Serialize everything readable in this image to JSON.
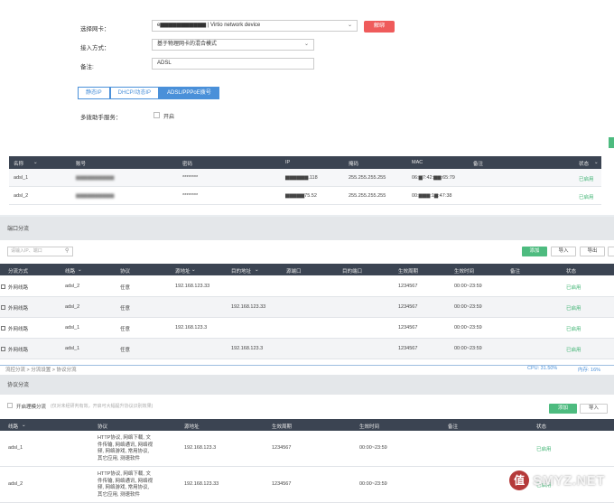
{
  "panel1": {
    "nic_label": "选择网卡：",
    "nic_value": "e▆▆▆▆▆▆▆▆▆▆▆ | Virtio network device",
    "unbind_button": "解绑",
    "access_label": "接入方式：",
    "access_value": "基于物理网卡的混合模式",
    "remark_label": "备注:",
    "remark_value": "ADSL",
    "tabs": [
      "静态IP",
      "DHCP/动态IP",
      "ADSL/PPPoE拨号"
    ],
    "active_tab": 2,
    "multi_service_label": "多拨助手服务：",
    "enable_label": "开启",
    "table": {
      "headers": [
        "名称",
        "账号",
        "密码",
        "IP",
        "掩码",
        "MAC",
        "备注",
        "状态"
      ],
      "rows": [
        [
          "adsl_1",
          "▆▆▆▆▆▆▆▆▆▆",
          "********",
          "▆▆▆▆▆▆.118",
          "255.255.255.255",
          "06:▆7:42:▆▆:65:79",
          "",
          "已启用"
        ],
        [
          "adsl_2",
          "▆▆▆▆▆▆▆▆▆▆",
          "********",
          "▆▆▆▆▆75.52",
          "255.255.255.255",
          "00:▆▆▆:1▆:47:38",
          "",
          "已启用"
        ]
      ]
    }
  },
  "panel2": {
    "title": "端口分流",
    "search_placeholder": "请输入IP、端口",
    "buttons": [
      "添加",
      "导入",
      "导出",
      ""
    ],
    "table": {
      "headers": [
        "分流方式",
        "线路",
        "协议",
        "源地址",
        "目的地址",
        "源端口",
        "目的端口",
        "生效周期",
        "生效时间",
        "备注",
        "状态"
      ],
      "rows": [
        [
          "外网线路",
          "adsl_2",
          "任意",
          "192.168.123.33",
          "",
          "",
          "",
          "1234567",
          "00:00~23:59",
          "",
          "已启用"
        ],
        [
          "外网线路",
          "adsl_2",
          "任意",
          "",
          "192.168.123.33",
          "",
          "",
          "1234567",
          "00:00~23:59",
          "",
          "已启用"
        ],
        [
          "外网线路",
          "adsl_1",
          "任意",
          "192.168.123.3",
          "",
          "",
          "",
          "1234567",
          "00:00~23:59",
          "",
          "已启用"
        ],
        [
          "外网线路",
          "adsl_1",
          "任意",
          "",
          "192.168.123.3",
          "",
          "",
          "1234567",
          "00:00~23:59",
          "",
          "已启用"
        ]
      ]
    }
  },
  "panel3": {
    "breadcrumb": "流控分流 > 分流设置 > 协议分流",
    "status_cpu": "CPU: 31.50%",
    "status_mem": "内存: 16%",
    "title": "协议分流",
    "checkbox_label": "开启理模分流",
    "checkbox_hint": "(仅对未经研判有效，开启可大幅提升协议识别效果)",
    "buttons": [
      "添加",
      "导入"
    ],
    "table": {
      "headers": [
        "线路",
        "协议",
        "源地址",
        "生效周期",
        "生效时间",
        "备注",
        "状态"
      ],
      "rows": [
        [
          "adsl_1",
          "HTTP协议, 网络下载, 文件传输, 网络通讯, 网络视频, 网络游戏, 常用协议, 其它应用, 测速软件",
          "192.168.123.3",
          "1234567",
          "00:00~23:59",
          "",
          "已启用"
        ],
        [
          "adsl_2",
          "HTTP协议, 网络下载, 文件传输, 网络通讯, 网络视频, 网络游戏, 常用协议, 其它应用, 测速软件",
          "192.168.123.33",
          "1234567",
          "00:00~23:59",
          "",
          "已启用"
        ]
      ]
    },
    "watermark_glyph": "值",
    "watermark": "SMYZ.NET"
  },
  "colors": {
    "header_bg": "#3b4452",
    "accent_blue": "#4a90d9",
    "green": "#4dbb7f",
    "red": "#ef5b5b",
    "enabled": "#3cb371"
  }
}
